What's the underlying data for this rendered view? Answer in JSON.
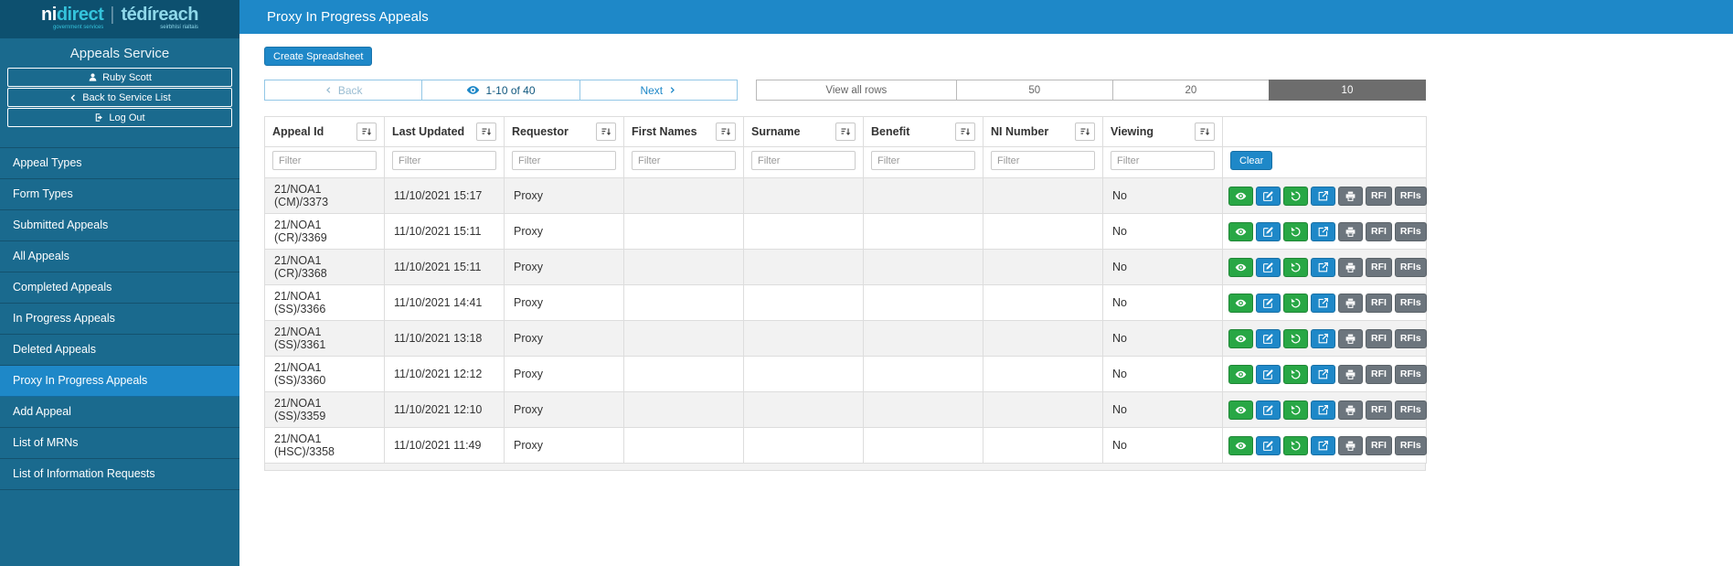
{
  "colors": {
    "accent": "#1e88c8",
    "sidebar": "#1a6a8e",
    "sidebar_dark": "#0d506f",
    "action_green": "#28a745",
    "action_gray": "#6c757d",
    "row_stripe": "#f2f2f2"
  },
  "sidebar": {
    "logo": {
      "ni": "ni",
      "direct": "direct",
      "divider": "|",
      "irish": "tédíreach",
      "tagline_en": "government services",
      "tagline_ga": "seirbhísí rialtais"
    },
    "service_title": "Appeals Service",
    "buttons": [
      {
        "label": "Ruby Scott",
        "icon": "person"
      },
      {
        "label": "Back to Service List",
        "icon": "chevron-left"
      },
      {
        "label": "Log Out",
        "icon": "logout"
      }
    ],
    "items": [
      {
        "label": "Appeal Types",
        "active": false
      },
      {
        "label": "Form Types",
        "active": false
      },
      {
        "label": "Submitted Appeals",
        "active": false
      },
      {
        "label": "All Appeals",
        "active": false
      },
      {
        "label": "Completed Appeals",
        "active": false
      },
      {
        "label": "In Progress Appeals",
        "active": false
      },
      {
        "label": "Deleted Appeals",
        "active": false
      },
      {
        "label": "Proxy In Progress Appeals",
        "active": true
      },
      {
        "label": "Add Appeal",
        "active": false
      },
      {
        "label": "List of MRNs",
        "active": false
      },
      {
        "label": "List of Information Requests",
        "active": false
      }
    ]
  },
  "header": {
    "title": "Proxy In Progress Appeals"
  },
  "toolbar": {
    "create_spreadsheet_label": "Create Spreadsheet"
  },
  "pagination": {
    "back_label": "Back",
    "range_label": "1-10 of 40",
    "next_label": "Next",
    "page_sizes": [
      {
        "label": "View all rows",
        "active": false
      },
      {
        "label": "50",
        "active": false
      },
      {
        "label": "20",
        "active": false
      },
      {
        "label": "10",
        "active": true
      }
    ]
  },
  "table": {
    "columns": [
      "Appeal Id",
      "Last Updated",
      "Requestor",
      "First Names",
      "Surname",
      "Benefit",
      "NI Number",
      "Viewing"
    ],
    "filter_placeholder": "Filter",
    "clear_label": "Clear",
    "row_actions": [
      {
        "name": "view",
        "icon": "eye",
        "style": "green"
      },
      {
        "name": "edit",
        "icon": "pencil-square",
        "style": "blue"
      },
      {
        "name": "undo",
        "icon": "undo",
        "style": "green"
      },
      {
        "name": "export",
        "icon": "box-arrow-up-right",
        "style": "blue"
      },
      {
        "name": "print",
        "icon": "printer",
        "style": "gray"
      },
      {
        "name": "rfi",
        "label": "RFI",
        "style": "gray"
      },
      {
        "name": "rfis",
        "label": "RFIs",
        "style": "gray"
      }
    ],
    "rows": [
      {
        "appeal_id": "21/NOA1 (CM)/3373",
        "last_updated": "11/10/2021 15:17",
        "requestor": "Proxy",
        "first_names": "",
        "surname": "",
        "benefit": "",
        "ni_number": "",
        "viewing": "No"
      },
      {
        "appeal_id": "21/NOA1 (CR)/3369",
        "last_updated": "11/10/2021 15:11",
        "requestor": "Proxy",
        "first_names": "",
        "surname": "",
        "benefit": "",
        "ni_number": "",
        "viewing": "No"
      },
      {
        "appeal_id": "21/NOA1 (CR)/3368",
        "last_updated": "11/10/2021 15:11",
        "requestor": "Proxy",
        "first_names": "",
        "surname": "",
        "benefit": "",
        "ni_number": "",
        "viewing": "No"
      },
      {
        "appeal_id": "21/NOA1 (SS)/3366",
        "last_updated": "11/10/2021 14:41",
        "requestor": "Proxy",
        "first_names": "",
        "surname": "",
        "benefit": "",
        "ni_number": "",
        "viewing": "No"
      },
      {
        "appeal_id": "21/NOA1 (SS)/3361",
        "last_updated": "11/10/2021 13:18",
        "requestor": "Proxy",
        "first_names": "",
        "surname": "",
        "benefit": "",
        "ni_number": "",
        "viewing": "No"
      },
      {
        "appeal_id": "21/NOA1 (SS)/3360",
        "last_updated": "11/10/2021 12:12",
        "requestor": "Proxy",
        "first_names": "",
        "surname": "",
        "benefit": "",
        "ni_number": "",
        "viewing": "No"
      },
      {
        "appeal_id": "21/NOA1 (SS)/3359",
        "last_updated": "11/10/2021 12:10",
        "requestor": "Proxy",
        "first_names": "",
        "surname": "",
        "benefit": "",
        "ni_number": "",
        "viewing": "No"
      },
      {
        "appeal_id": "21/NOA1 (HSC)/3358",
        "last_updated": "11/10/2021 11:49",
        "requestor": "Proxy",
        "first_names": "",
        "surname": "",
        "benefit": "",
        "ni_number": "",
        "viewing": "No"
      }
    ]
  }
}
